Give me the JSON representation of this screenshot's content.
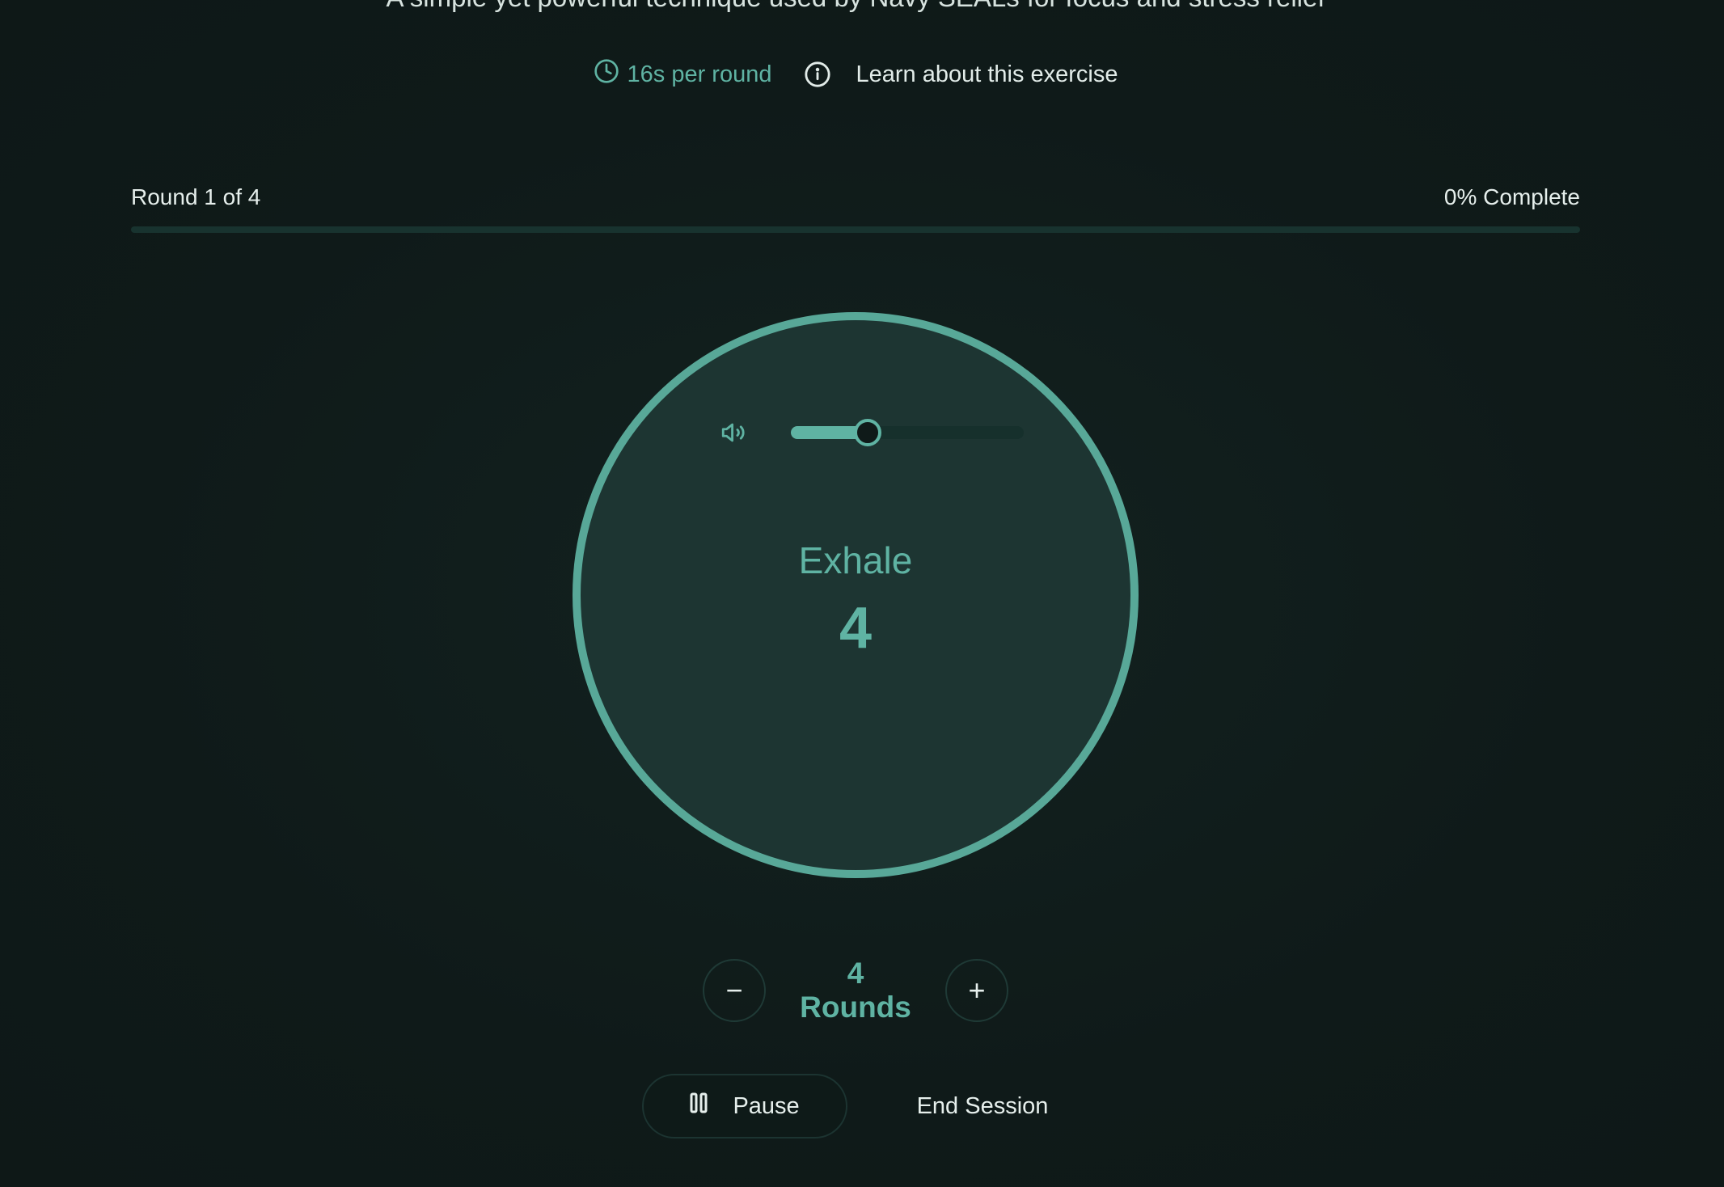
{
  "header": {
    "subtitle": "A simple yet powerful technique used by Navy SEALs for focus and stress relief",
    "per_round": "16s per round",
    "learn_link": "Learn about this exercise"
  },
  "progress": {
    "round_text": "Round 1 of 4",
    "complete_text": "0% Complete",
    "fraction": 0.0
  },
  "breath": {
    "phase": "Exhale",
    "count": "4",
    "volume_fraction": 0.33
  },
  "rounds": {
    "label": "4 Rounds",
    "decrement_symbol": "−",
    "increment_symbol": "+"
  },
  "actions": {
    "pause_label": "Pause",
    "end_label": "End Session"
  },
  "colors": {
    "accent": "#5fb3a3",
    "background": "#0f1a19",
    "circle_fill": "#1d3532"
  },
  "icons": {
    "clock": "clock-icon",
    "info": "info-icon",
    "volume": "volume-icon",
    "pause": "pause-icon"
  }
}
